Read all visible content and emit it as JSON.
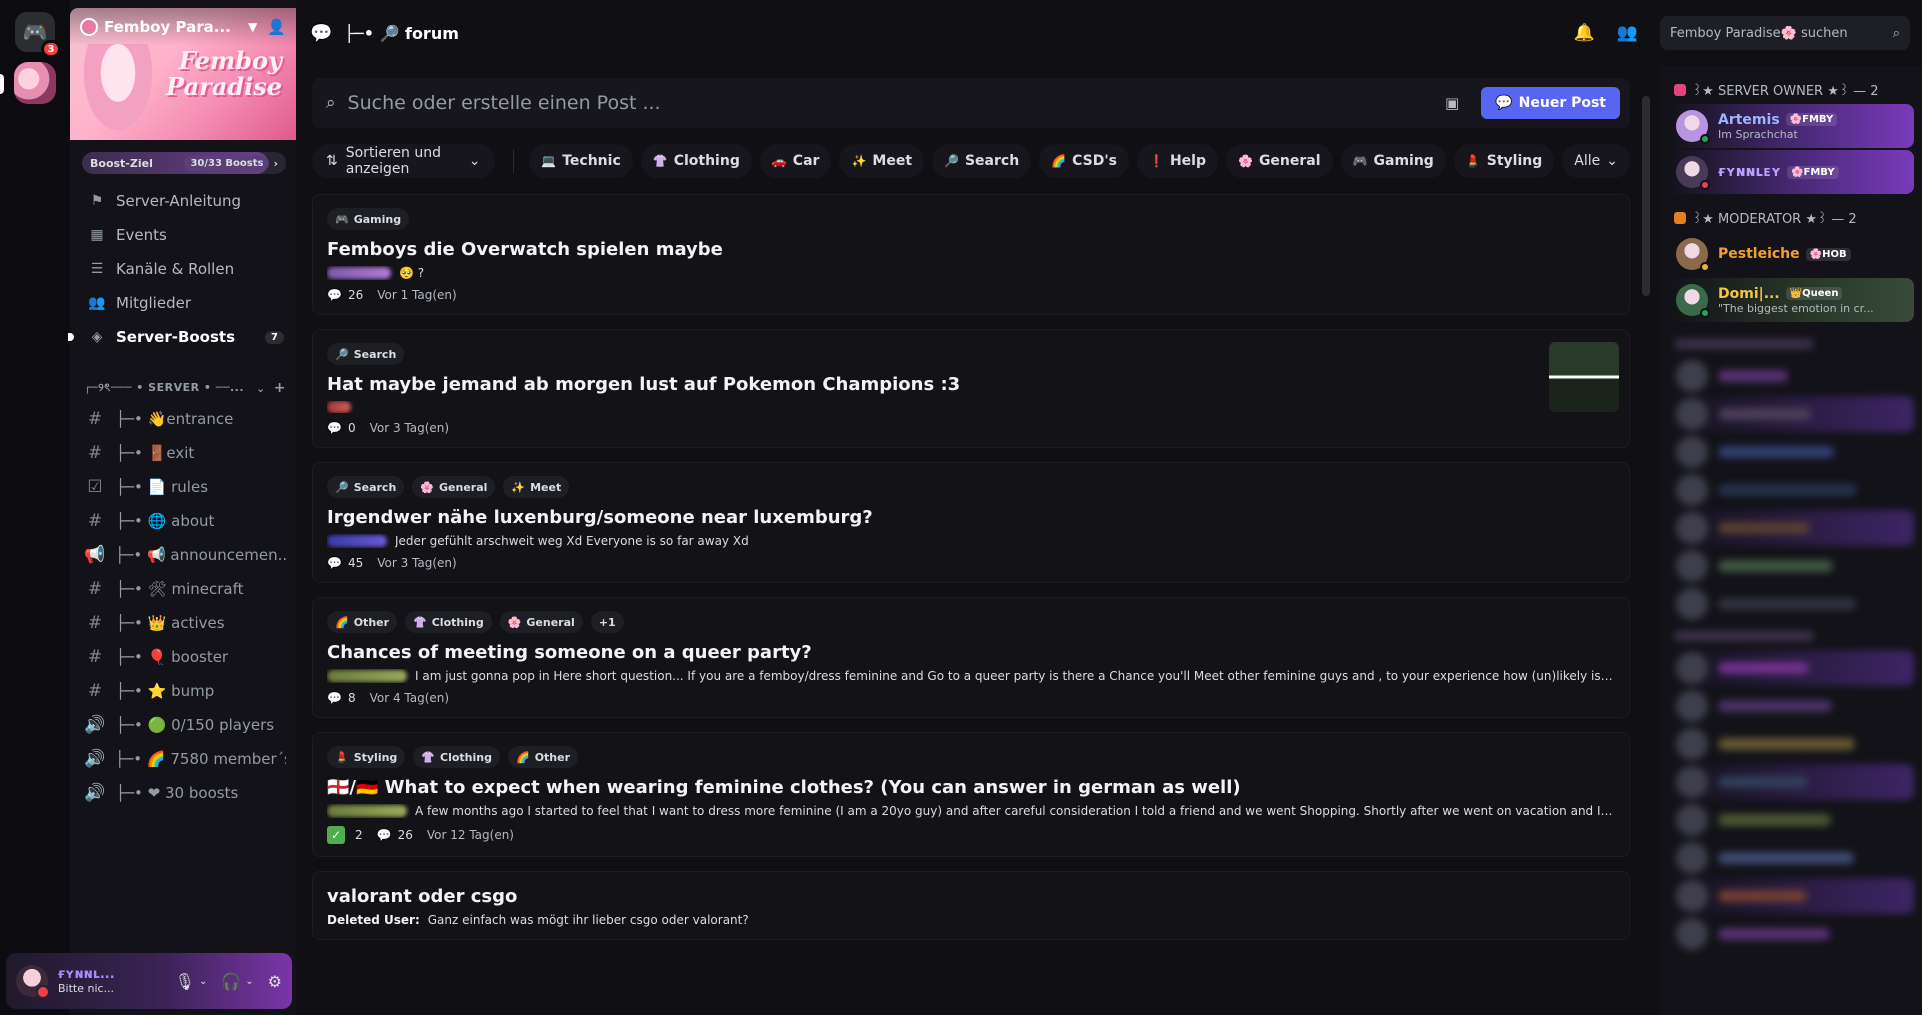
{
  "rail": {
    "dm_badge": "3"
  },
  "server": {
    "name": "Femboy Para...",
    "banner_logo": "Femboy Paradise",
    "boost_goal": "Boost-Ziel",
    "boost_count": "30/33 Boosts",
    "boost_progress": 0.91
  },
  "nav": [
    {
      "label": "Server-Anleitung",
      "icon": "signpost-icon"
    },
    {
      "label": "Events",
      "icon": "calendar-icon"
    },
    {
      "label": "Kanäle & Rollen",
      "icon": "channels-roles-icon"
    },
    {
      "label": "Mitglieder",
      "icon": "members-icon"
    },
    {
      "label": "Server-Boosts",
      "icon": "boost-icon",
      "count": "7"
    }
  ],
  "category": {
    "label": "┌─୨ৎ─── • SERVER • ──..."
  },
  "channels": [
    {
      "name": "├─• 👋entrance",
      "type": "text"
    },
    {
      "name": "├─• 🚪exit",
      "type": "text"
    },
    {
      "name": "├─• 📄 rules",
      "type": "rules"
    },
    {
      "name": "├─• 🌐 about",
      "type": "text"
    },
    {
      "name": "├─• 📢 announcemen...",
      "type": "announcement"
    },
    {
      "name": "├─• 🛠 minecraft",
      "type": "text"
    },
    {
      "name": "├─• 👑 actives",
      "type": "text"
    },
    {
      "name": "├─• 🎈 booster",
      "type": "text"
    },
    {
      "name": "├─• ⭐ bump",
      "type": "text"
    },
    {
      "name": "├─• 🟢 0/150 players",
      "type": "voice"
    },
    {
      "name": "├─• 🌈 7580 member´s",
      "type": "voice"
    },
    {
      "name": "├─• ❤ 30 boosts",
      "type": "voice"
    }
  ],
  "user": {
    "name": "ғʏɴɴʟ...",
    "status": "Bitte nic..."
  },
  "topbar": {
    "channel": "├─• 🔎 forum",
    "search_placeholder": "Femboy Paradise🌸 suchen"
  },
  "forum": {
    "search_placeholder": "Suche oder erstelle einen Post ...",
    "new_post": "Neuer Post",
    "sort_label": "Sortieren und anzeigen",
    "filter_tags": [
      {
        "emoji": "💻",
        "label": "Technic"
      },
      {
        "emoji": "👚",
        "label": "Clothing"
      },
      {
        "emoji": "🚗",
        "label": "Car"
      },
      {
        "emoji": "✨",
        "label": "Meet"
      },
      {
        "emoji": "🔎",
        "label": "Search"
      },
      {
        "emoji": "🌈",
        "label": "CSD's"
      },
      {
        "emoji": "❗",
        "label": "Help"
      },
      {
        "emoji": "🌸",
        "label": "General"
      },
      {
        "emoji": "🎮",
        "label": "Gaming"
      },
      {
        "emoji": "💄",
        "label": "Styling"
      }
    ],
    "all_label": "Alle",
    "posts": [
      {
        "tags": [
          {
            "emoji": "🎮",
            "label": "Gaming"
          }
        ],
        "title": "Femboys die Overwatch spielen maybe",
        "preview": "🥺 ?",
        "author_blur": "purple",
        "comments": "26",
        "time": "Vor 1 Tag(en)"
      },
      {
        "tags": [
          {
            "emoji": "🔎",
            "label": "Search"
          }
        ],
        "title": "Hat maybe jemand ab morgen lust auf Pokemon Champions :3",
        "preview": "",
        "author_blur": "red",
        "comments": "0",
        "time": "Vor 3 Tag(en)",
        "thumbnail": true
      },
      {
        "tags": [
          {
            "emoji": "🔎",
            "label": "Search"
          },
          {
            "emoji": "🌸",
            "label": "General"
          },
          {
            "emoji": "✨",
            "label": "Meet"
          }
        ],
        "title": "Irgendwer nähe luxenburg/someone near luxemburg?",
        "preview": "Jeder gefühlt arschweit weg Xd Everyone is so far away Xd",
        "author_blur": "blue",
        "comments": "45",
        "time": "Vor 3 Tag(en)"
      },
      {
        "tags": [
          {
            "emoji": "🌈",
            "label": "Other"
          },
          {
            "emoji": "👚",
            "label": "Clothing"
          },
          {
            "emoji": "🌸",
            "label": "General"
          },
          {
            "emoji": "",
            "label": "+1"
          }
        ],
        "title": "Chances of meeting someone on a queer party?",
        "preview": "I am just gonna pop in Here short question... If you are a femboy/dress feminine and Go to a queer party is there a Chance you'll Meet other feminine guys and , to your experience how (un)likely is it th...",
        "author_blur": "green",
        "comments": "8",
        "time": "Vor 4 Tag(en)"
      },
      {
        "tags": [
          {
            "emoji": "💄",
            "label": "Styling"
          },
          {
            "emoji": "👚",
            "label": "Clothing"
          },
          {
            "emoji": "🌈",
            "label": "Other"
          }
        ],
        "title": "🏴󠁧󠁢󠁥󠁮󠁧󠁿/🇩🇪 What to expect when wearing feminine clothes? (You can answer in german as well)",
        "preview": "A few months ago I started to feel that I want to dress more feminine (I am a 20yo guy) and after careful consideration I told a friend and we went Shopping. Shortly after we went on vacation and I did...",
        "author_blur": "green",
        "reaction": "2",
        "comments": "26",
        "time": "Vor 12 Tag(en)"
      },
      {
        "tags": [],
        "title": "valorant oder csgo",
        "preview_author": "Deleted User:",
        "preview": "Ganz einfach was mögt ihr lieber csgo oder valorant?",
        "comments": "",
        "time": ""
      }
    ]
  },
  "members": {
    "roles": [
      {
        "label": "꒱★ SERVER OWNER ★꒱ — 2",
        "color": "#e0457b",
        "members": [
          {
            "name": "Artemis",
            "tag": "🌸FMBY",
            "sub": "Im Sprachchat",
            "color": "#9fb4ff",
            "status": "#23a55a",
            "highlight": true
          },
          {
            "name": "ғʏɴɴʟᴇʏ",
            "tag": "🌸FMBY",
            "sub": "",
            "color": "#bca0ff",
            "status": "#f23f43",
            "highlight": true
          }
        ]
      },
      {
        "label": "꒱★ MODERATOR ★꒱ — 2",
        "color": "#e67e22",
        "members": [
          {
            "name": "Pestleiche",
            "tag": "🌸HOB",
            "sub": "",
            "color": "#f0a030",
            "status": "#f0b232",
            "highlight": false
          },
          {
            "name": "Domi|...",
            "tag": "👑Queen",
            "sub": "\"The biggest emotion in cr...",
            "color": "#f5c542",
            "status": "#23a55a",
            "highlight": true
          }
        ]
      }
    ]
  }
}
